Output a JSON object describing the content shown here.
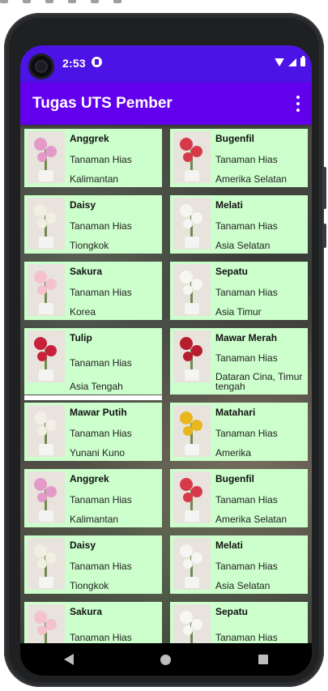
{
  "status_bar": {
    "time": "2:53"
  },
  "app_bar": {
    "title": "Tugas UTS Pember"
  },
  "plants": [
    {
      "name": "Anggrek",
      "type": "Tanaman Hias",
      "origin": "Kalimantan",
      "icon": "orchid-image",
      "color": "#e49ac9"
    },
    {
      "name": "Bugenfil",
      "type": "Tanaman Hias",
      "origin": "Amerika Selatan",
      "icon": "bougainvillea-image",
      "color": "#d63a4a"
    },
    {
      "name": "Daisy",
      "type": "Tanaman Hias",
      "origin": "Tiongkok",
      "icon": "daisy-image",
      "color": "#f1efe2"
    },
    {
      "name": "Melati",
      "type": "Tanaman Hias",
      "origin": "Asia Selatan",
      "icon": "jasmine-image",
      "color": "#f5f5f2"
    },
    {
      "name": "Sakura",
      "type": "Tanaman Hias",
      "origin": "Korea",
      "icon": "sakura-image",
      "color": "#f3c2cc"
    },
    {
      "name": "Sepatu",
      "type": "Tanaman Hias",
      "origin": "Asia Timur",
      "icon": "hibiscus-image",
      "color": "#f7f7f2"
    },
    {
      "name": "Tulip",
      "type": "Tanaman Hias",
      "origin": "Asia Tengah",
      "icon": "tulip-image",
      "color": "#c8223a"
    },
    {
      "name": "Mawar Merah",
      "type": "Tanaman Hias",
      "origin": "Dataran Cina, Timur tengah",
      "icon": "red-rose-image",
      "color": "#b81d2e"
    },
    {
      "name": "Mawar Putih",
      "type": "Tanaman Hias",
      "origin": "Yunani Kuno",
      "icon": "white-rose-image",
      "color": "#f2efe6"
    },
    {
      "name": "Matahari",
      "type": "Tanaman Hias",
      "origin": "Amerika",
      "icon": "sunflower-image",
      "color": "#e9b61d"
    },
    {
      "name": "Anggrek",
      "type": "Tanaman Hias",
      "origin": "Kalimantan",
      "icon": "orchid-image",
      "color": "#e49ac9"
    },
    {
      "name": "Bugenfil",
      "type": "Tanaman Hias",
      "origin": "Amerika Selatan",
      "icon": "bougainvillea-image",
      "color": "#d63a4a"
    },
    {
      "name": "Daisy",
      "type": "Tanaman Hias",
      "origin": "Tiongkok",
      "icon": "daisy-image",
      "color": "#f1efe2"
    },
    {
      "name": "Melati",
      "type": "Tanaman Hias",
      "origin": "Asia Selatan",
      "icon": "jasmine-image",
      "color": "#f5f5f2"
    },
    {
      "name": "Sakura",
      "type": "Tanaman Hias",
      "origin": "",
      "icon": "sakura-image",
      "color": "#f3c2cc"
    },
    {
      "name": "Sepatu",
      "type": "Tanaman Hias",
      "origin": "",
      "icon": "hibiscus-image",
      "color": "#f7f7f2"
    }
  ],
  "colors": {
    "status_bar": "#4b13e6",
    "app_bar": "#6200ee",
    "card_bg": "#ccffcc"
  }
}
